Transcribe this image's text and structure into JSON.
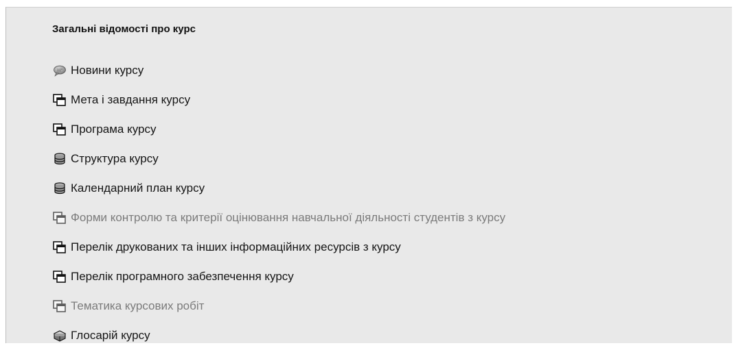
{
  "section": {
    "title": "Загальні відомості про курс"
  },
  "items": [
    {
      "label": "Новини курсу",
      "icon": "forum-speech-bubble-icon",
      "muted": false
    },
    {
      "label": "Мета і завдання курсу",
      "icon": "resource-window-icon",
      "muted": false
    },
    {
      "label": "Програма курсу",
      "icon": "resource-window-icon",
      "muted": false
    },
    {
      "label": "Структура курсу",
      "icon": "database-icon",
      "muted": false
    },
    {
      "label": "Календарний план курсу",
      "icon": "database-icon",
      "muted": false
    },
    {
      "label": "Форми контролю та критерії оцінювання навчальної діяльності студентів з курсу",
      "icon": "resource-window-icon",
      "muted": true
    },
    {
      "label": "Перелік друкованих та інших інформаційних ресурсів з курсу",
      "icon": "resource-window-icon",
      "muted": false
    },
    {
      "label": "Перелік програмного забезпечення курсу",
      "icon": "resource-window-icon",
      "muted": false
    },
    {
      "label": "Тематика курсових робіт",
      "icon": "resource-window-icon",
      "muted": true
    },
    {
      "label": "Глосарій курсу",
      "icon": "glossary-books-icon",
      "muted": false
    }
  ]
}
